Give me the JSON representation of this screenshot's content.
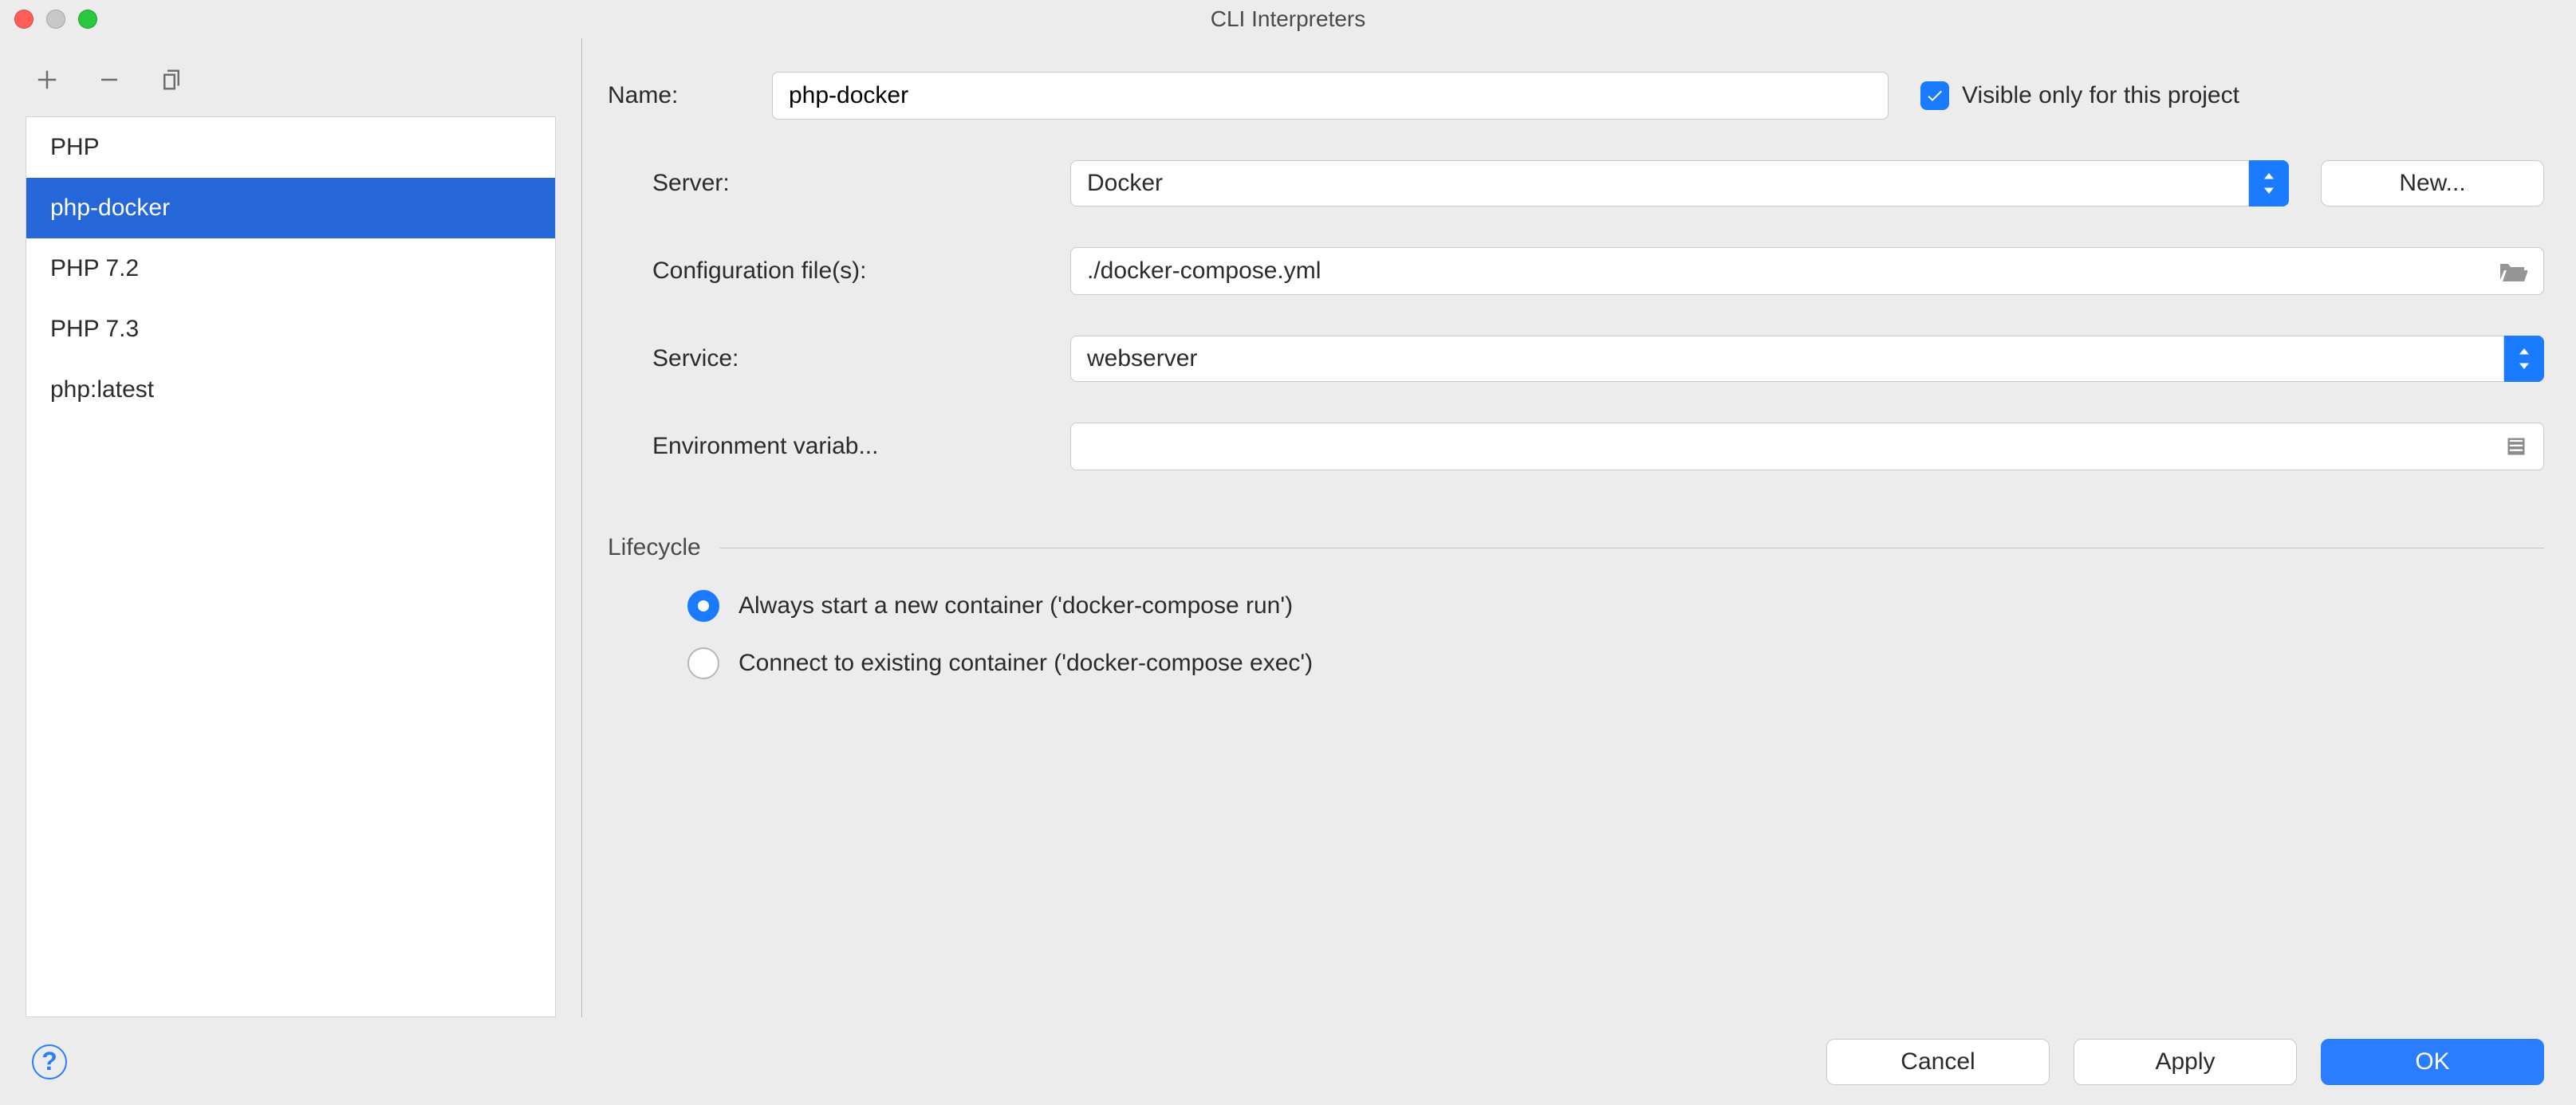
{
  "window": {
    "title": "CLI Interpreters"
  },
  "sidebar": {
    "items": [
      {
        "label": "PHP"
      },
      {
        "label": "php-docker"
      },
      {
        "label": "PHP 7.2"
      },
      {
        "label": "PHP 7.3"
      },
      {
        "label": "php:latest"
      }
    ],
    "selected_index": 1
  },
  "form": {
    "name_label": "Name:",
    "name_value": "php-docker",
    "visible_label": "Visible only for this project",
    "visible_checked": true,
    "server_label": "Server:",
    "server_value": "Docker",
    "new_button": "New...",
    "config_label": "Configuration file(s):",
    "config_value": "./docker-compose.yml",
    "service_label": "Service:",
    "service_value": "webserver",
    "env_label": "Environment variab...",
    "env_value": ""
  },
  "lifecycle": {
    "title": "Lifecycle",
    "options": [
      {
        "label": "Always start a new container ('docker-compose run')",
        "checked": true
      },
      {
        "label": "Connect to existing container ('docker-compose exec')",
        "checked": false
      }
    ]
  },
  "footer": {
    "cancel": "Cancel",
    "apply": "Apply",
    "ok": "OK"
  }
}
